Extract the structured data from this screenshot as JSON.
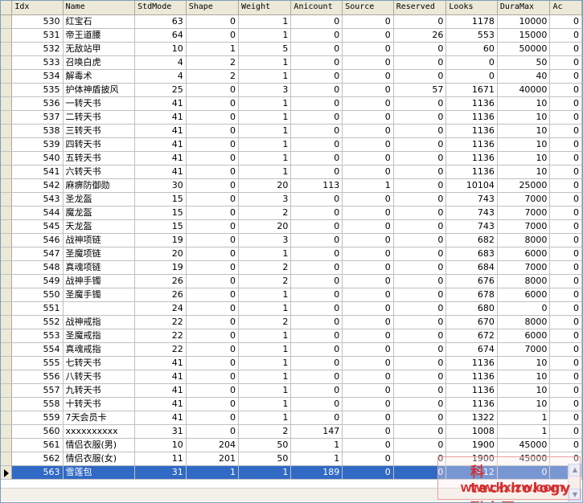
{
  "grid": {
    "columns": [
      "Idx",
      "Name",
      "StdMode",
      "Shape",
      "Weight",
      "Anicount",
      "Source",
      "Reserved",
      "Looks",
      "DuraMax",
      "Ac"
    ],
    "rows": [
      [
        "530",
        "红宝石",
        "63",
        "0",
        "1",
        "0",
        "0",
        "0",
        "1178",
        "10000",
        "0"
      ],
      [
        "531",
        "帝王道腰",
        "64",
        "0",
        "1",
        "0",
        "0",
        "26",
        "553",
        "15000",
        "0"
      ],
      [
        "532",
        "无敌站甲",
        "10",
        "1",
        "5",
        "0",
        "0",
        "0",
        "60",
        "50000",
        "0"
      ],
      [
        "533",
        "召唤白虎",
        "4",
        "2",
        "1",
        "0",
        "0",
        "0",
        "0",
        "50",
        "0"
      ],
      [
        "534",
        "解毒术",
        "4",
        "2",
        "1",
        "0",
        "0",
        "0",
        "0",
        "40",
        "0"
      ],
      [
        "535",
        "护体神盾披风",
        "25",
        "0",
        "3",
        "0",
        "0",
        "57",
        "1671",
        "40000",
        "0"
      ],
      [
        "536",
        "一转天书",
        "41",
        "0",
        "1",
        "0",
        "0",
        "0",
        "1136",
        "10",
        "0"
      ],
      [
        "537",
        "二转天书",
        "41",
        "0",
        "1",
        "0",
        "0",
        "0",
        "1136",
        "10",
        "0"
      ],
      [
        "538",
        "三转天书",
        "41",
        "0",
        "1",
        "0",
        "0",
        "0",
        "1136",
        "10",
        "0"
      ],
      [
        "539",
        "四转天书",
        "41",
        "0",
        "1",
        "0",
        "0",
        "0",
        "1136",
        "10",
        "0"
      ],
      [
        "540",
        "五转天书",
        "41",
        "0",
        "1",
        "0",
        "0",
        "0",
        "1136",
        "10",
        "0"
      ],
      [
        "541",
        "六转天书",
        "41",
        "0",
        "1",
        "0",
        "0",
        "0",
        "1136",
        "10",
        "0"
      ],
      [
        "542",
        "麻痹防御勋",
        "30",
        "0",
        "20",
        "113",
        "1",
        "0",
        "10104",
        "25000",
        "0"
      ],
      [
        "543",
        "圣龙盔",
        "15",
        "0",
        "3",
        "0",
        "0",
        "0",
        "743",
        "7000",
        "0"
      ],
      [
        "544",
        "魔龙盔",
        "15",
        "0",
        "2",
        "0",
        "0",
        "0",
        "743",
        "7000",
        "0"
      ],
      [
        "545",
        "天龙盔",
        "15",
        "0",
        "20",
        "0",
        "0",
        "0",
        "743",
        "7000",
        "0"
      ],
      [
        "546",
        "战神项链",
        "19",
        "0",
        "3",
        "0",
        "0",
        "0",
        "682",
        "8000",
        "0"
      ],
      [
        "547",
        "圣魔项链",
        "20",
        "0",
        "1",
        "0",
        "0",
        "0",
        "683",
        "6000",
        "0"
      ],
      [
        "548",
        "真魂项链",
        "19",
        "0",
        "2",
        "0",
        "0",
        "0",
        "684",
        "7000",
        "0"
      ],
      [
        "549",
        "战神手镯",
        "26",
        "0",
        "2",
        "0",
        "0",
        "0",
        "676",
        "8000",
        "0"
      ],
      [
        "550",
        "圣魔手镯",
        "26",
        "0",
        "1",
        "0",
        "0",
        "0",
        "678",
        "6000",
        "0"
      ],
      [
        "551",
        "",
        "24",
        "0",
        "1",
        "0",
        "0",
        "0",
        "680",
        "0",
        "0"
      ],
      [
        "552",
        "战神戒指",
        "22",
        "0",
        "2",
        "0",
        "0",
        "0",
        "670",
        "8000",
        "0"
      ],
      [
        "553",
        "圣魔戒指",
        "22",
        "0",
        "1",
        "0",
        "0",
        "0",
        "672",
        "6000",
        "0"
      ],
      [
        "554",
        "真魂戒指",
        "22",
        "0",
        "1",
        "0",
        "0",
        "0",
        "674",
        "7000",
        "0"
      ],
      [
        "555",
        "七转天书",
        "41",
        "0",
        "1",
        "0",
        "0",
        "0",
        "1136",
        "10",
        "0"
      ],
      [
        "556",
        "八转天书",
        "41",
        "0",
        "1",
        "0",
        "0",
        "0",
        "1136",
        "10",
        "0"
      ],
      [
        "557",
        "九转天书",
        "41",
        "0",
        "1",
        "0",
        "0",
        "0",
        "1136",
        "10",
        "0"
      ],
      [
        "558",
        "十转天书",
        "41",
        "0",
        "1",
        "0",
        "0",
        "0",
        "1136",
        "10",
        "0"
      ],
      [
        "559",
        "7天会员卡",
        "41",
        "0",
        "1",
        "0",
        "0",
        "0",
        "1322",
        "1",
        "0"
      ],
      [
        "560",
        "xxxxxxxxxx",
        "31",
        "0",
        "2",
        "147",
        "0",
        "0",
        "1008",
        "1",
        "0"
      ],
      [
        "561",
        "情侣衣服(男)",
        "10",
        "204",
        "50",
        "1",
        "0",
        "0",
        "1900",
        "45000",
        "0"
      ],
      [
        "562",
        "情侣衣服(女)",
        "11",
        "201",
        "50",
        "1",
        "0",
        "0",
        "1900",
        "45000",
        "0"
      ],
      [
        "563",
        "雪莲包",
        "31",
        "1",
        "1",
        "189",
        "0",
        "0",
        "412",
        "0",
        "0"
      ]
    ],
    "selected_row": 33
  },
  "watermark": {
    "line1": "科technology联众网",
    "line2": "www.kxlzw.com"
  },
  "scrollbar": {
    "up_icon": "triangle-up-icon",
    "down_icon": "triangle-down-icon"
  }
}
